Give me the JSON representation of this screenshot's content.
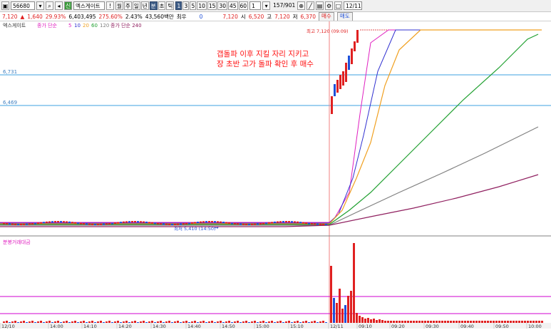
{
  "toolbar": {
    "code": "56680",
    "stock_name": "엑스게이트",
    "period_buttons": [
      "월",
      "주",
      "일",
      "년",
      "분",
      "초",
      "틱"
    ],
    "interval_buttons": [
      "1",
      "3",
      "5",
      "10",
      "15",
      "30",
      "45",
      "60"
    ],
    "count_value": "1",
    "page_info": "157/901",
    "date_value": "12/11"
  },
  "quote": {
    "price": "7,120",
    "change": "1,640",
    "rate": "29.93%",
    "volume": "6,403,495",
    "vol_ratio": "275.60%",
    "turnover": "2.43%",
    "amount": "43,560백만",
    "best_label": "최우",
    "best_value": "0",
    "current": "7,120",
    "open_label": "시",
    "open_value": "6,520",
    "high_label": "고",
    "high_value": "7,120",
    "low_label": "저",
    "low_value": "6,370",
    "buy_label": "매수",
    "sell_label": "매도"
  },
  "colors": {
    "up": "#e02020",
    "down": "#1f4fd8",
    "ma5": "#e020c0",
    "ma10": "#3030d0",
    "ma20": "#f0a020",
    "ma60": "#20a030",
    "ma120": "#808080",
    "ma240": "#902060",
    "hline": "#3fa0e0",
    "vline": "#f08080",
    "vol_line": "#d000d0"
  },
  "price_panel": {
    "legend_name": "엑스게이트",
    "legend_ma_label": "종가 단순",
    "legend_ma_periods": [
      "5",
      "10",
      "20",
      "60",
      "120"
    ],
    "legend_ma240": "종가 단순 240",
    "level_label_1": "6,731",
    "level_label_2": "6,469",
    "high_annotation": "최고 7,120 (09:09)",
    "low_annotation": "최저 5,410 (14:50)",
    "note_line1": "갭돌파 이후 지킬 자리 지키고",
    "note_line2": "장 초반 고가 돌파 확인 후 매수"
  },
  "volume_panel": {
    "legend": "분봉거래대금"
  },
  "x_axis": {
    "ticks": [
      "12/10",
      "14:00",
      "14:10",
      "14:20",
      "14:30",
      "14:40",
      "14:50",
      "15:00",
      "15:10",
      "12/11",
      "09:10",
      "09:20",
      "09:30",
      "09:40",
      "09:50",
      "10:00"
    ]
  }
}
